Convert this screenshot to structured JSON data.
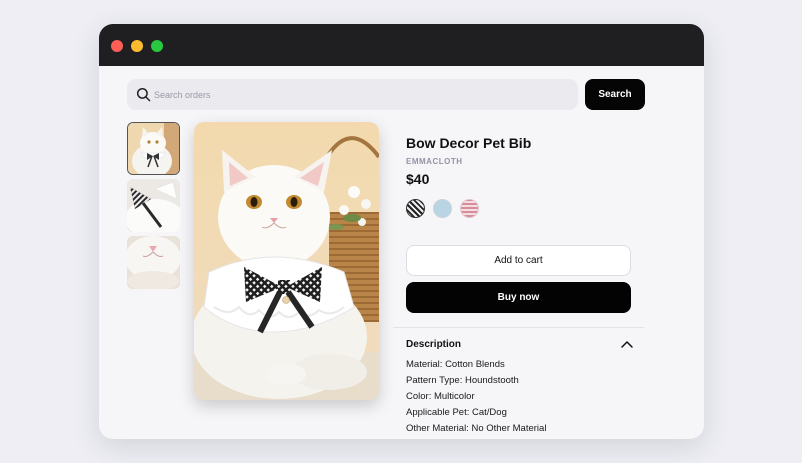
{
  "search": {
    "placeholder": "Search orders",
    "button_label": "Search"
  },
  "product": {
    "title": "Bow Decor Pet Bib",
    "brand": "EMMACLOTH",
    "price": "$40"
  },
  "colors": {
    "swatches": [
      "#2a2a2a",
      "#b9d4e2",
      "#e8b6c0"
    ],
    "button_primary": "#050505",
    "window_chrome": "#1f1f22"
  },
  "actions": {
    "add_to_cart": "Add to cart",
    "buy_now": "Buy now"
  },
  "description": {
    "title": "Description",
    "lines": [
      "Material: Cotton Blends",
      "Pattern Type: Houndstooth",
      "Color: Multicolor",
      "Applicable Pet: Cat/Dog",
      "Other Material: No Other Material"
    ]
  }
}
